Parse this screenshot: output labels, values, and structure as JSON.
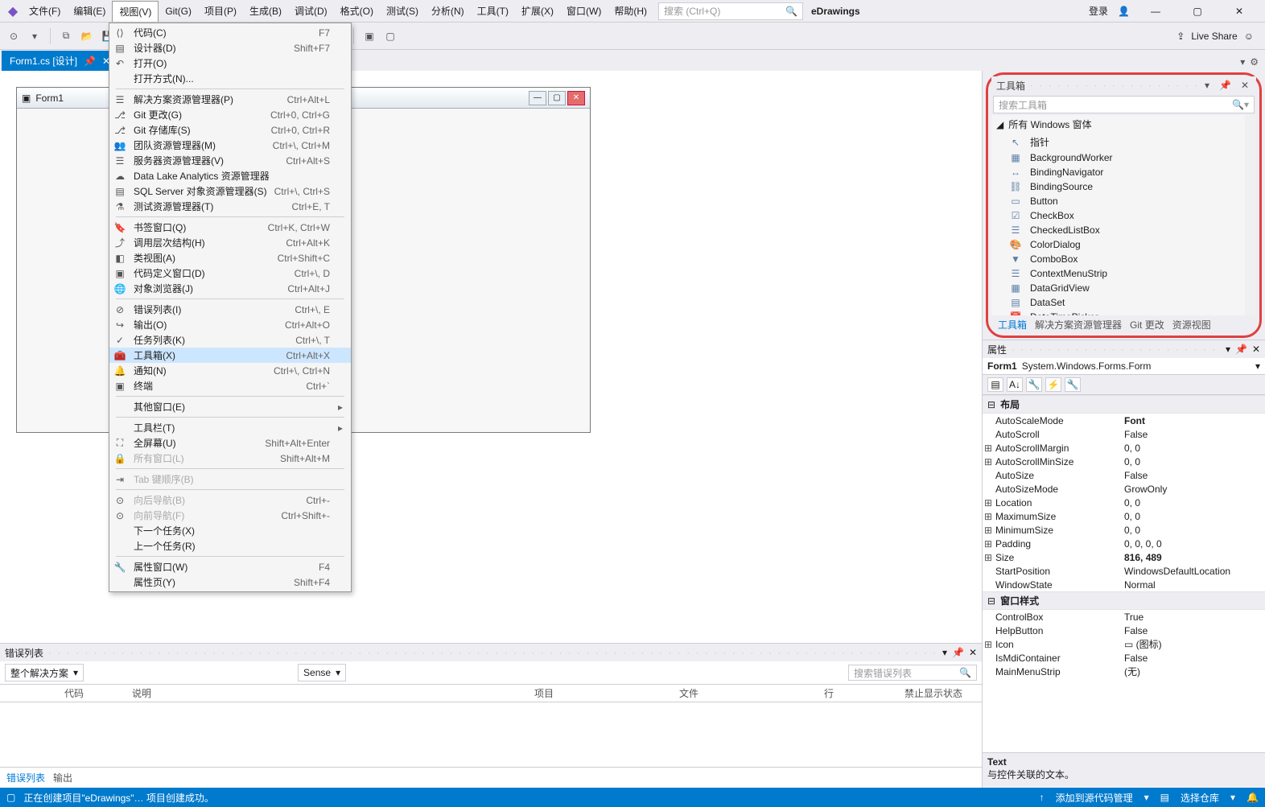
{
  "menubar": {
    "items": [
      "文件(F)",
      "编辑(E)",
      "视图(V)",
      "Git(G)",
      "项目(P)",
      "生成(B)",
      "调试(D)",
      "格式(O)",
      "测试(S)",
      "分析(N)",
      "工具(T)",
      "扩展(X)",
      "窗口(W)",
      "帮助(H)"
    ],
    "search_placeholder": "搜索 (Ctrl+Q)",
    "title": "eDrawings",
    "login": "登录"
  },
  "toolbar": {
    "liveshare": "Live Share"
  },
  "doc_tab": {
    "label": "Form1.cs [设计]"
  },
  "designer": {
    "title": "Form1"
  },
  "view_menu": {
    "items": [
      {
        "icon": "⟨⟩",
        "label": "代码(C)",
        "shortcut": "F7"
      },
      {
        "icon": "▤",
        "label": "设计器(D)",
        "shortcut": "Shift+F7"
      },
      {
        "icon": "↶",
        "label": "打开(O)",
        "shortcut": ""
      },
      {
        "icon": "",
        "label": "打开方式(N)...",
        "shortcut": ""
      },
      {
        "sep": true
      },
      {
        "icon": "☰",
        "label": "解决方案资源管理器(P)",
        "shortcut": "Ctrl+Alt+L"
      },
      {
        "icon": "⎇",
        "label": "Git 更改(G)",
        "shortcut": "Ctrl+0, Ctrl+G"
      },
      {
        "icon": "⎇",
        "label": "Git 存储库(S)",
        "shortcut": "Ctrl+0, Ctrl+R"
      },
      {
        "icon": "👥",
        "label": "团队资源管理器(M)",
        "shortcut": "Ctrl+\\, Ctrl+M"
      },
      {
        "icon": "☰",
        "label": "服务器资源管理器(V)",
        "shortcut": "Ctrl+Alt+S"
      },
      {
        "icon": "☁",
        "label": "Data Lake Analytics 资源管理器",
        "shortcut": ""
      },
      {
        "icon": "▤",
        "label": "SQL Server 对象资源管理器(S)",
        "shortcut": "Ctrl+\\, Ctrl+S"
      },
      {
        "icon": "⚗",
        "label": "测试资源管理器(T)",
        "shortcut": "Ctrl+E, T"
      },
      {
        "sep": true
      },
      {
        "icon": "🔖",
        "label": "书签窗口(Q)",
        "shortcut": "Ctrl+K, Ctrl+W"
      },
      {
        "icon": "⤴",
        "label": "调用层次结构(H)",
        "shortcut": "Ctrl+Alt+K"
      },
      {
        "icon": "◧",
        "label": "类视图(A)",
        "shortcut": "Ctrl+Shift+C"
      },
      {
        "icon": "▣",
        "label": "代码定义窗口(D)",
        "shortcut": "Ctrl+\\, D"
      },
      {
        "icon": "🌐",
        "label": "对象浏览器(J)",
        "shortcut": "Ctrl+Alt+J"
      },
      {
        "sep": true
      },
      {
        "icon": "⊘",
        "label": "错误列表(I)",
        "shortcut": "Ctrl+\\, E"
      },
      {
        "icon": "↪",
        "label": "输出(O)",
        "shortcut": "Ctrl+Alt+O"
      },
      {
        "icon": "✓",
        "label": "任务列表(K)",
        "shortcut": "Ctrl+\\, T"
      },
      {
        "icon": "🧰",
        "label": "工具箱(X)",
        "shortcut": "Ctrl+Alt+X",
        "selected": true
      },
      {
        "icon": "🔔",
        "label": "通知(N)",
        "shortcut": "Ctrl+\\, Ctrl+N"
      },
      {
        "icon": "▣",
        "label": "终端",
        "shortcut": "Ctrl+`"
      },
      {
        "sep": true
      },
      {
        "icon": "",
        "label": "其他窗口(E)",
        "shortcut": "",
        "sub": true
      },
      {
        "sep": true
      },
      {
        "icon": "",
        "label": "工具栏(T)",
        "shortcut": "",
        "sub": true
      },
      {
        "icon": "⛶",
        "label": "全屏幕(U)",
        "shortcut": "Shift+Alt+Enter"
      },
      {
        "icon": "🔒",
        "label": "所有窗口(L)",
        "shortcut": "Shift+Alt+M",
        "dis": true
      },
      {
        "sep": true
      },
      {
        "icon": "⇥",
        "label": "Tab 键顺序(B)",
        "shortcut": "",
        "dis": true
      },
      {
        "sep": true
      },
      {
        "icon": "⊙",
        "label": "向后导航(B)",
        "shortcut": "Ctrl+-",
        "dis": true
      },
      {
        "icon": "⊙",
        "label": "向前导航(F)",
        "shortcut": "Ctrl+Shift+-",
        "dis": true
      },
      {
        "icon": "",
        "label": "下一个任务(X)",
        "shortcut": ""
      },
      {
        "icon": "",
        "label": "上一个任务(R)",
        "shortcut": ""
      },
      {
        "sep": true
      },
      {
        "icon": "🔧",
        "label": "属性窗口(W)",
        "shortcut": "F4"
      },
      {
        "icon": "",
        "label": "属性页(Y)",
        "shortcut": "Shift+F4"
      }
    ]
  },
  "toolbox_panel": {
    "title": "工具箱",
    "search_placeholder": "搜索工具箱",
    "category": "所有 Windows 窗体",
    "items": [
      {
        "icon": "↖",
        "label": "指针"
      },
      {
        "icon": "▦",
        "label": "BackgroundWorker"
      },
      {
        "icon": "↔",
        "label": "BindingNavigator"
      },
      {
        "icon": "⛓",
        "label": "BindingSource"
      },
      {
        "icon": "▭",
        "label": "Button"
      },
      {
        "icon": "☑",
        "label": "CheckBox"
      },
      {
        "icon": "☰",
        "label": "CheckedListBox"
      },
      {
        "icon": "🎨",
        "label": "ColorDialog"
      },
      {
        "icon": "▼",
        "label": "ComboBox"
      },
      {
        "icon": "☰",
        "label": "ContextMenuStrip"
      },
      {
        "icon": "▦",
        "label": "DataGridView"
      },
      {
        "icon": "▤",
        "label": "DataSet"
      },
      {
        "icon": "📅",
        "label": "DateTimePicker"
      }
    ],
    "tabs": [
      "工具箱",
      "解决方案资源管理器",
      "Git 更改",
      "资源视图"
    ]
  },
  "properties_panel": {
    "title": "属性",
    "subject_name": "Form1",
    "subject_type": "System.Windows.Forms.Form",
    "cats": [
      {
        "name": "布局",
        "rows": [
          {
            "k": "AutoScaleMode",
            "v": "Font",
            "bold": true
          },
          {
            "k": "AutoScroll",
            "v": "False"
          },
          {
            "exp": "⊞",
            "k": "AutoScrollMargin",
            "v": "0, 0"
          },
          {
            "exp": "⊞",
            "k": "AutoScrollMinSize",
            "v": "0, 0"
          },
          {
            "k": "AutoSize",
            "v": "False"
          },
          {
            "k": "AutoSizeMode",
            "v": "GrowOnly"
          },
          {
            "exp": "⊞",
            "k": "Location",
            "v": "0, 0"
          },
          {
            "exp": "⊞",
            "k": "MaximumSize",
            "v": "0, 0"
          },
          {
            "exp": "⊞",
            "k": "MinimumSize",
            "v": "0, 0"
          },
          {
            "exp": "⊞",
            "k": "Padding",
            "v": "0, 0, 0, 0"
          },
          {
            "exp": "⊞",
            "k": "Size",
            "v": "816, 489",
            "bold": true
          },
          {
            "k": "StartPosition",
            "v": "WindowsDefaultLocation"
          },
          {
            "k": "WindowState",
            "v": "Normal"
          }
        ]
      },
      {
        "name": "窗口样式",
        "rows": [
          {
            "k": "ControlBox",
            "v": "True"
          },
          {
            "k": "HelpButton",
            "v": "False"
          },
          {
            "exp": "⊞",
            "k": "Icon",
            "v": "▭  (图标)"
          },
          {
            "k": "IsMdiContainer",
            "v": "False"
          },
          {
            "k": "MainMenuStrip",
            "v": "(无)"
          }
        ]
      }
    ],
    "desc_title": "Text",
    "desc_body": "与控件关联的文本。"
  },
  "error_panel": {
    "title": "错误列表",
    "scope": "整个解决方案",
    "sense_label": "Sense",
    "search_placeholder": "搜索错误列表",
    "cols": [
      "代码",
      "说明",
      "项目",
      "文件",
      "行",
      "禁止显示状态"
    ],
    "tabs": [
      "错误列表",
      "输出"
    ]
  },
  "statusbar": {
    "msg": "正在创建项目\"eDrawings\"… 项目创建成功。",
    "src": "添加到源代码管理",
    "repo": "选择仓库"
  },
  "side_tab": "..."
}
